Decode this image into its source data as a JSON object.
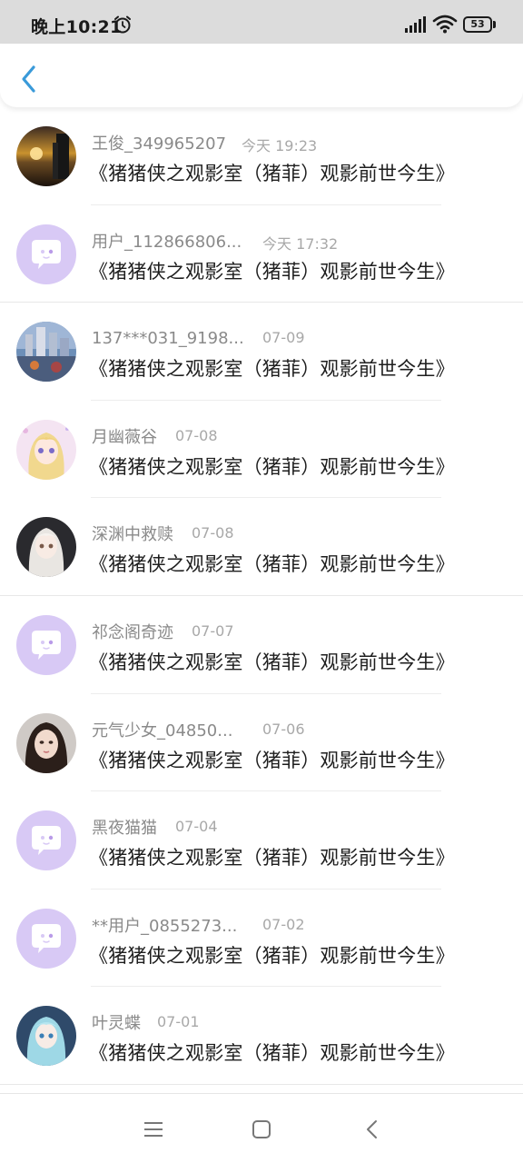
{
  "status_bar": {
    "time": "晚上10:21",
    "battery": "53",
    "icons": [
      "alarm-icon",
      "signal-icon",
      "wifi-icon",
      "battery-icon"
    ]
  },
  "header": {
    "back_icon": "chevron-left-icon",
    "accent_color": "#3a9ad9"
  },
  "items": [
    {
      "name": "王俊_349965207",
      "time": "今天 19:23",
      "title": "《猪猪侠之观影室（猪菲）观影前世今生》",
      "avatar": "sunset-photo"
    },
    {
      "name": "用户_112866806...",
      "time": "今天 17:32",
      "title": "《猪猪侠之观影室（猪菲）观影前世今生》",
      "avatar": "default-chat-avatar"
    },
    {
      "name": "137***031_9198...",
      "time": "07-09",
      "title": "《猪猪侠之观影室（猪菲）观影前世今生》",
      "avatar": "city-photo"
    },
    {
      "name": "月幽薇谷",
      "time": "07-08",
      "title": "《猪猪侠之观影室（猪菲）观影前世今生》",
      "avatar": "anime-girl-blonde"
    },
    {
      "name": "深渊中救赎",
      "time": "07-08",
      "title": "《猪猪侠之观影室（猪菲）观影前世今生》",
      "avatar": "anime-girl-silver"
    },
    {
      "name": "祁念阁奇迹",
      "time": "07-07",
      "title": "《猪猪侠之观影室（猪菲）观影前世今生》",
      "avatar": "default-chat-avatar"
    },
    {
      "name": "元气少女_04850...",
      "time": "07-06",
      "title": "《猪猪侠之观影室（猪菲）观影前世今生》",
      "avatar": "girl-portrait"
    },
    {
      "name": "黑夜猫猫",
      "time": "07-04",
      "title": "《猪猪侠之观影室（猪菲）观影前世今生》",
      "avatar": "default-chat-avatar"
    },
    {
      "name": "**用户_0855273...",
      "time": "07-02",
      "title": "《猪猪侠之观影室（猪菲）观影前世今生》",
      "avatar": "default-chat-avatar"
    },
    {
      "name": "叶灵蝶",
      "time": "07-01",
      "title": "《猪猪侠之观影室（猪菲）观影前世今生》",
      "avatar": "anime-girl-teal"
    }
  ],
  "nav_bar": {
    "icons": [
      "menu-icon",
      "home-icon",
      "back-icon"
    ]
  },
  "colors": {
    "default_avatar_bg": "#d8c9f5",
    "default_avatar_bubble": "#ffffff"
  }
}
